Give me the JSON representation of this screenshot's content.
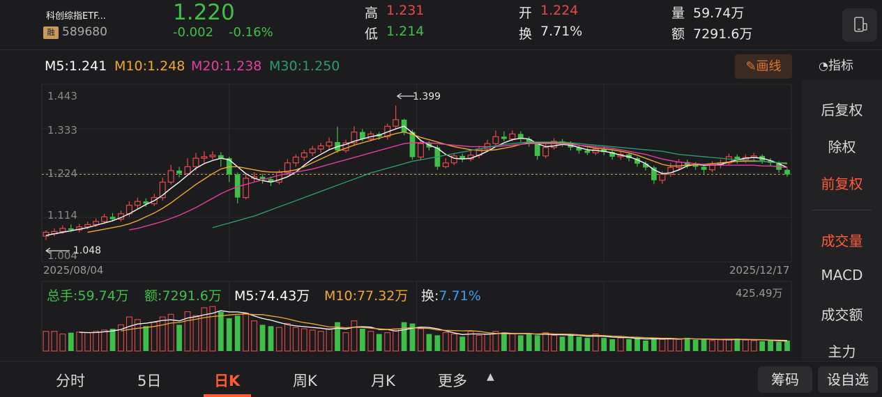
{
  "header": {
    "fund_name": "科创综指ETF...",
    "badge": "融",
    "code": "589680",
    "price": "1.220",
    "change": "-0.002",
    "change_pct": "-0.16%",
    "high_label": "高",
    "high": "1.231",
    "low_label": "低",
    "low": "1.214",
    "open_label": "开",
    "open": "1.224",
    "turnover_label": "换",
    "turnover": "7.71%",
    "volume_label": "量",
    "volume": "59.74万",
    "amount_label": "额",
    "amount": "7291.6万"
  },
  "ma_bar": {
    "m5": "M5:1.241",
    "m10": "M10:1.248",
    "m20": "M20:1.238",
    "m30": "M30:1.250",
    "draw_button": "画线",
    "indicator_button": "指标"
  },
  "colors": {
    "up": "#e84a4a",
    "down": "#3fbf4a",
    "m5": "#ffffff",
    "m10": "#f0a830",
    "m20": "#e040a0",
    "m30": "#2a9a70",
    "accent": "#ff5a36"
  },
  "chart_data": {
    "type": "candlestick",
    "y_ticks": [
      "1.443",
      "1.333",
      "1.224",
      "1.114",
      "1.004"
    ],
    "y_range": [
      1.004,
      1.443
    ],
    "max_label": "1.399",
    "min_label": "1.048",
    "current_price": 1.22,
    "date_start": "2025/08/04",
    "date_end": "2025/12/17",
    "candles": [
      [
        1.06,
        1.07,
        1.075,
        1.05
      ],
      [
        1.066,
        1.072,
        1.08,
        1.06
      ],
      [
        1.072,
        1.08,
        1.088,
        1.066
      ],
      [
        1.08,
        1.076,
        1.09,
        1.07
      ],
      [
        1.076,
        1.084,
        1.092,
        1.07
      ],
      [
        1.084,
        1.09,
        1.098,
        1.078
      ],
      [
        1.09,
        1.098,
        1.106,
        1.084
      ],
      [
        1.098,
        1.11,
        1.118,
        1.092
      ],
      [
        1.11,
        1.104,
        1.12,
        1.098
      ],
      [
        1.104,
        1.118,
        1.126,
        1.098
      ],
      [
        1.118,
        1.14,
        1.15,
        1.11
      ],
      [
        1.14,
        1.15,
        1.16,
        1.132
      ],
      [
        1.15,
        1.144,
        1.158,
        1.136
      ],
      [
        1.144,
        1.16,
        1.17,
        1.138
      ],
      [
        1.16,
        1.2,
        1.212,
        1.152
      ],
      [
        1.2,
        1.23,
        1.245,
        1.194
      ],
      [
        1.23,
        1.222,
        1.24,
        1.212
      ],
      [
        1.222,
        1.24,
        1.262,
        1.216
      ],
      [
        1.24,
        1.262,
        1.276,
        1.23
      ],
      [
        1.262,
        1.266,
        1.28,
        1.25
      ],
      [
        1.266,
        1.27,
        1.28,
        1.258
      ],
      [
        1.27,
        1.262,
        1.278,
        1.24
      ],
      [
        1.262,
        1.22,
        1.266,
        1.2
      ],
      [
        1.22,
        1.16,
        1.225,
        1.145
      ],
      [
        1.16,
        1.21,
        1.222,
        1.155
      ],
      [
        1.21,
        1.214,
        1.226,
        1.2
      ],
      [
        1.214,
        1.208,
        1.222,
        1.196
      ],
      [
        1.208,
        1.2,
        1.214,
        1.19
      ],
      [
        1.2,
        1.225,
        1.232,
        1.194
      ],
      [
        1.225,
        1.25,
        1.26,
        1.218
      ],
      [
        1.25,
        1.265,
        1.272,
        1.24
      ],
      [
        1.265,
        1.276,
        1.284,
        1.256
      ],
      [
        1.276,
        1.286,
        1.294,
        1.268
      ],
      [
        1.286,
        1.294,
        1.302,
        1.276
      ],
      [
        1.294,
        1.304,
        1.316,
        1.284
      ],
      [
        1.304,
        1.282,
        1.344,
        1.276
      ],
      [
        1.282,
        1.302,
        1.31,
        1.276
      ],
      [
        1.302,
        1.33,
        1.345,
        1.294
      ],
      [
        1.33,
        1.312,
        1.338,
        1.306
      ],
      [
        1.312,
        1.325,
        1.332,
        1.306
      ],
      [
        1.325,
        1.318,
        1.33,
        1.31
      ],
      [
        1.318,
        1.345,
        1.352,
        1.31
      ],
      [
        1.345,
        1.362,
        1.399,
        1.336
      ],
      [
        1.362,
        1.33,
        1.364,
        1.322
      ],
      [
        1.33,
        1.265,
        1.336,
        1.258
      ],
      [
        1.265,
        1.3,
        1.31,
        1.258
      ],
      [
        1.3,
        1.29,
        1.306,
        1.282
      ],
      [
        1.29,
        1.24,
        1.296,
        1.232
      ],
      [
        1.24,
        1.25,
        1.262,
        1.236
      ],
      [
        1.25,
        1.268,
        1.276,
        1.244
      ],
      [
        1.268,
        1.26,
        1.274,
        1.252
      ],
      [
        1.26,
        1.27,
        1.282,
        1.254
      ],
      [
        1.27,
        1.286,
        1.294,
        1.262
      ],
      [
        1.286,
        1.3,
        1.31,
        1.28
      ],
      [
        1.3,
        1.318,
        1.334,
        1.294
      ],
      [
        1.318,
        1.312,
        1.332,
        1.306
      ],
      [
        1.312,
        1.325,
        1.334,
        1.306
      ],
      [
        1.325,
        1.312,
        1.332,
        1.304
      ],
      [
        1.312,
        1.3,
        1.318,
        1.292
      ],
      [
        1.3,
        1.268,
        1.304,
        1.258
      ],
      [
        1.268,
        1.29,
        1.3,
        1.262
      ],
      [
        1.29,
        1.306,
        1.314,
        1.284
      ],
      [
        1.306,
        1.3,
        1.312,
        1.292
      ],
      [
        1.3,
        1.29,
        1.306,
        1.282
      ],
      [
        1.29,
        1.282,
        1.296,
        1.274
      ],
      [
        1.282,
        1.276,
        1.29,
        1.27
      ],
      [
        1.276,
        1.286,
        1.294,
        1.27
      ],
      [
        1.286,
        1.278,
        1.292,
        1.27
      ],
      [
        1.278,
        1.266,
        1.284,
        1.258
      ],
      [
        1.266,
        1.272,
        1.28,
        1.258
      ],
      [
        1.272,
        1.262,
        1.276,
        1.254
      ],
      [
        1.262,
        1.248,
        1.266,
        1.24
      ],
      [
        1.248,
        1.238,
        1.254,
        1.23
      ],
      [
        1.238,
        1.205,
        1.242,
        1.195
      ],
      [
        1.205,
        1.22,
        1.228,
        1.196
      ],
      [
        1.22,
        1.238,
        1.25,
        1.214
      ],
      [
        1.238,
        1.252,
        1.26,
        1.232
      ],
      [
        1.252,
        1.245,
        1.258,
        1.236
      ],
      [
        1.245,
        1.24,
        1.252,
        1.232
      ],
      [
        1.24,
        1.232,
        1.246,
        1.222
      ],
      [
        1.232,
        1.245,
        1.254,
        1.226
      ],
      [
        1.245,
        1.25,
        1.258,
        1.236
      ],
      [
        1.25,
        1.266,
        1.274,
        1.244
      ],
      [
        1.266,
        1.258,
        1.272,
        1.248
      ],
      [
        1.258,
        1.264,
        1.272,
        1.25
      ],
      [
        1.264,
        1.268,
        1.276,
        1.256
      ],
      [
        1.268,
        1.256,
        1.272,
        1.248
      ],
      [
        1.256,
        1.25,
        1.262,
        1.242
      ],
      [
        1.25,
        1.232,
        1.254,
        1.224
      ],
      [
        1.232,
        1.22,
        1.236,
        1.214
      ]
    ],
    "series": [
      {
        "name": "M5",
        "values": [
          1.062,
          1.066,
          1.07,
          1.074,
          1.078,
          1.082,
          1.088,
          1.094,
          1.1,
          1.108,
          1.118,
          1.13,
          1.142,
          1.152,
          1.166,
          1.184,
          1.2,
          1.218,
          1.236,
          1.248,
          1.256,
          1.262,
          1.258,
          1.24,
          1.222,
          1.21,
          1.204,
          1.2,
          1.206,
          1.214,
          1.226,
          1.244,
          1.26,
          1.272,
          1.284,
          1.292,
          1.298,
          1.306,
          1.312,
          1.318,
          1.322,
          1.33,
          1.338,
          1.345,
          1.328,
          1.308,
          1.296,
          1.288,
          1.272,
          1.262,
          1.26,
          1.262,
          1.27,
          1.28,
          1.292,
          1.302,
          1.31,
          1.314,
          1.312,
          1.3,
          1.292,
          1.294,
          1.298,
          1.296,
          1.29,
          1.284,
          1.282,
          1.28,
          1.276,
          1.27,
          1.266,
          1.258,
          1.248,
          1.232,
          1.222,
          1.224,
          1.232,
          1.242,
          1.246,
          1.244,
          1.244,
          1.246,
          1.252,
          1.258,
          1.262,
          1.264,
          1.262,
          1.256,
          1.248,
          1.238
        ]
      },
      {
        "name": "M10",
        "values": [
          null,
          null,
          null,
          null,
          null,
          1.07,
          1.074,
          1.078,
          1.082,
          1.086,
          1.092,
          1.1,
          1.11,
          1.12,
          1.132,
          1.146,
          1.162,
          1.178,
          1.194,
          1.208,
          1.222,
          1.234,
          1.24,
          1.24,
          1.236,
          1.232,
          1.228,
          1.226,
          1.226,
          1.228,
          1.232,
          1.24,
          1.25,
          1.26,
          1.27,
          1.28,
          1.288,
          1.296,
          1.302,
          1.308,
          1.314,
          1.32,
          1.326,
          1.33,
          1.324,
          1.316,
          1.31,
          1.304,
          1.298,
          1.292,
          1.288,
          1.284,
          1.282,
          1.282,
          1.284,
          1.288,
          1.292,
          1.298,
          1.302,
          1.302,
          1.302,
          1.302,
          1.302,
          1.3,
          1.296,
          1.292,
          1.288,
          1.286,
          1.284,
          1.28,
          1.276,
          1.27,
          1.262,
          1.254,
          1.246,
          1.242,
          1.242,
          1.244,
          1.246,
          1.246,
          1.248,
          1.25,
          1.252,
          1.254,
          1.254,
          1.254,
          1.254,
          1.252,
          1.25,
          1.248
        ]
      },
      {
        "name": "M20",
        "values": [
          null,
          null,
          null,
          null,
          null,
          null,
          null,
          null,
          null,
          null,
          1.076,
          1.08,
          1.086,
          1.092,
          1.098,
          1.106,
          1.114,
          1.124,
          1.134,
          1.146,
          1.158,
          1.17,
          1.18,
          1.188,
          1.194,
          1.2,
          1.206,
          1.212,
          1.218,
          1.222,
          1.226,
          1.23,
          1.234,
          1.24,
          1.246,
          1.252,
          1.258,
          1.264,
          1.27,
          1.276,
          1.282,
          1.288,
          1.294,
          1.3,
          1.302,
          1.302,
          1.302,
          1.3,
          1.298,
          1.296,
          1.294,
          1.292,
          1.292,
          1.292,
          1.292,
          1.294,
          1.296,
          1.298,
          1.3,
          1.3,
          1.3,
          1.3,
          1.3,
          1.298,
          1.296,
          1.294,
          1.292,
          1.29,
          1.288,
          1.284,
          1.28,
          1.276,
          1.272,
          1.266,
          1.26,
          1.256,
          1.252,
          1.25,
          1.248,
          1.246,
          1.244,
          1.244,
          1.244,
          1.244,
          1.244,
          1.244,
          1.242,
          1.242,
          1.24,
          1.238
        ]
      },
      {
        "name": "M30",
        "values": [
          null,
          null,
          null,
          null,
          null,
          null,
          null,
          null,
          null,
          null,
          null,
          null,
          null,
          null,
          null,
          null,
          null,
          null,
          null,
          null,
          1.082,
          1.088,
          1.094,
          1.1,
          1.106,
          1.112,
          1.12,
          1.128,
          1.136,
          1.144,
          1.152,
          1.16,
          1.168,
          1.176,
          1.184,
          1.192,
          1.2,
          1.208,
          1.216,
          1.224,
          1.23,
          1.236,
          1.242,
          1.248,
          1.254,
          1.258,
          1.262,
          1.266,
          1.27,
          1.274,
          1.278,
          1.282,
          1.286,
          1.29,
          1.294,
          1.298,
          1.3,
          1.302,
          1.304,
          1.304,
          1.304,
          1.304,
          1.304,
          1.302,
          1.3,
          1.298,
          1.296,
          1.294,
          1.292,
          1.29,
          1.288,
          1.286,
          1.284,
          1.282,
          1.28,
          1.276,
          1.272,
          1.27,
          1.268,
          1.266,
          1.264,
          1.262,
          1.26,
          1.258,
          1.256,
          1.256,
          1.254,
          1.252,
          1.25,
          1.25
        ]
      }
    ],
    "volume": {
      "total_label": "总手:59.74万",
      "amount_label": "额:7291.6万",
      "m5_label": "M5:74.43万",
      "m10_label": "M10:77.32万",
      "turnover_label_prefix": "换:",
      "turnover_value": "7.71%",
      "max_label": "425.49万",
      "values": [
        150,
        150,
        130,
        140,
        145,
        140,
        150,
        160,
        170,
        200,
        260,
        240,
        190,
        220,
        260,
        280,
        200,
        300,
        270,
        330,
        340,
        300,
        250,
        270,
        290,
        230,
        200,
        190,
        180,
        210,
        180,
        170,
        160,
        150,
        170,
        220,
        140,
        230,
        170,
        150,
        130,
        140,
        170,
        220,
        210,
        170,
        130,
        120,
        140,
        130,
        110,
        150,
        120,
        130,
        150,
        140,
        130,
        120,
        130,
        120,
        140,
        120,
        110,
        120,
        110,
        100,
        130,
        100,
        90,
        100,
        90,
        100,
        80,
        100,
        90,
        95,
        90,
        100,
        85,
        90,
        80,
        85,
        90,
        95,
        85,
        80,
        75,
        80,
        70,
        80
      ]
    }
  },
  "right_panel": {
    "items": [
      "后复权",
      "除权",
      "前复权",
      "成交量",
      "MACD",
      "成交额",
      "主力"
    ]
  },
  "tabs": [
    "分时",
    "5日",
    "日K",
    "周K",
    "月K",
    "更多"
  ],
  "bottom_buttons": [
    "筹码",
    "设自选"
  ]
}
